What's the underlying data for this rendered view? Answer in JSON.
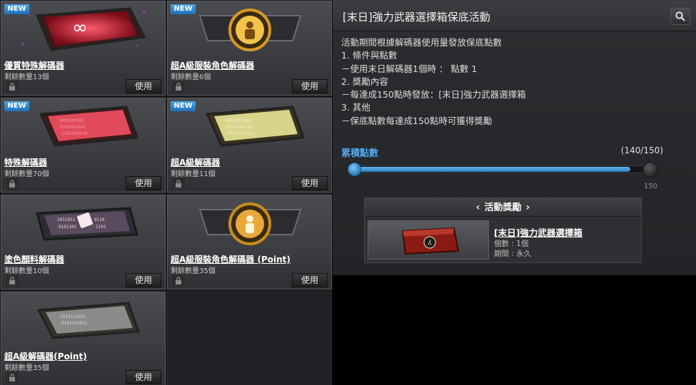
{
  "items": [
    {
      "name": "優質特殊解碼器",
      "count": "剩餘數量13個",
      "badge": "NEW",
      "use": "使用",
      "icon": "decoder-infinity-red-icon"
    },
    {
      "name": "超A級服裝角色解碼器",
      "count": "剩餘數量6個",
      "badge": "NEW",
      "use": "使用",
      "icon": "decoder-character-gold-icon"
    },
    {
      "name": "特殊解碼器",
      "count": "剩餘數量70個",
      "badge": "NEW",
      "use": "使用",
      "icon": "decoder-red-icon"
    },
    {
      "name": "超A級解碼器",
      "count": "剩餘數量11個",
      "badge": "NEW",
      "use": "使用",
      "icon": "decoder-yellow-icon"
    },
    {
      "name": "塗色顏料解碼器",
      "count": "剩餘數量10個",
      "badge": "",
      "use": "使用",
      "icon": "decoder-paint-icon"
    },
    {
      "name": "超A級服裝角色解碼器 (Point)",
      "count": "剩餘數量35個",
      "badge": "",
      "use": "使用",
      "icon": "decoder-character-point-icon"
    },
    {
      "name": "超A級解碼器(Point)",
      "count": "剩餘數量35個",
      "badge": "",
      "use": "使用",
      "icon": "decoder-silver-icon"
    }
  ],
  "panel": {
    "title": "[末日]強力武器選擇箱保底活動",
    "description": [
      "活動期間根據解碼器使用量發放保底點數",
      "1. 條件與點數",
      "－使用末日解碼器1個時 ： 點數 1",
      "2. 獎勵內容",
      "－每達成150點時發放：[末日]強力武器選擇箱",
      "3. 其他",
      "－保底點數每達成150點時可獲得獎勵"
    ],
    "points_label": "累積點數",
    "points_value": "(140/150)",
    "progress": {
      "current": 140,
      "max": 150
    },
    "progress_max_label": "150",
    "reward": {
      "header": "活動獎勵",
      "prev": "‹",
      "next": "›",
      "name": "[末日]強力武器選擇箱",
      "quantity": "個數 : 1個",
      "period": "期間 : 永久"
    }
  },
  "colors": {
    "accent": "#52a9ec",
    "badge": "#2f86d0"
  }
}
